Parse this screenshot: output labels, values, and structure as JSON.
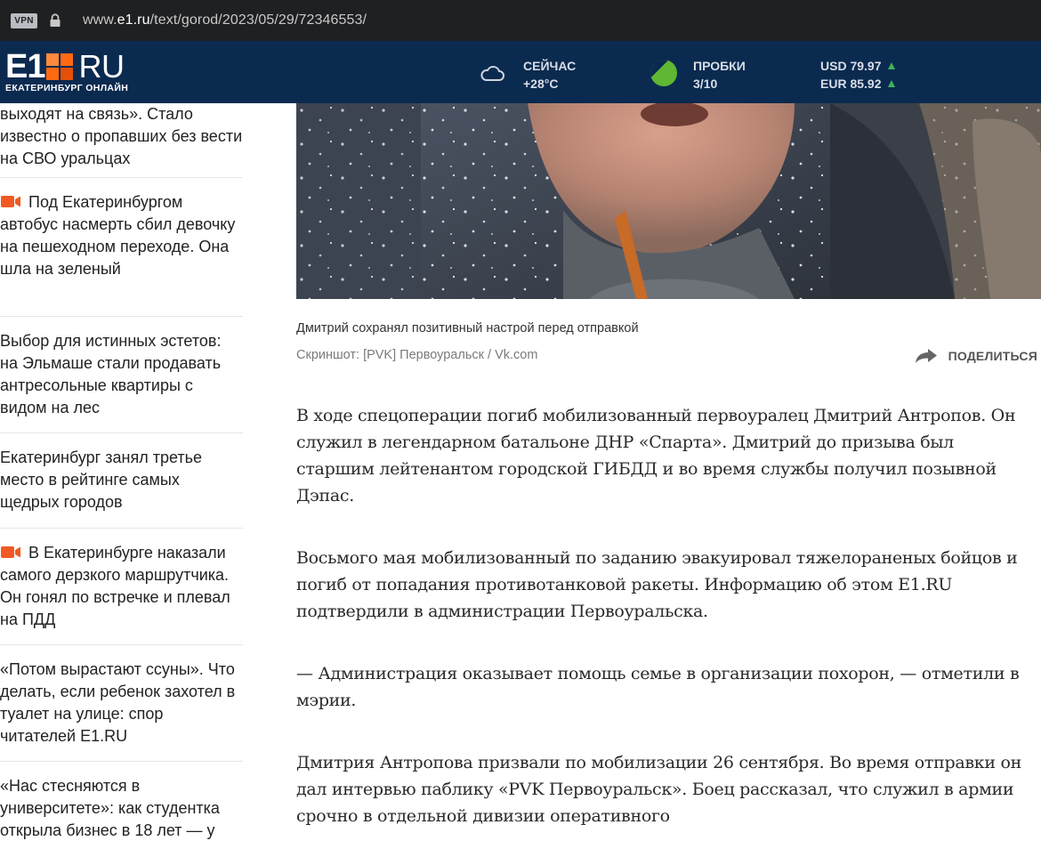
{
  "browser": {
    "vpn_badge": "VPN",
    "url_prefix": "www.",
    "url_domain": "e1.ru",
    "url_path": "/text/gorod/2023/05/29/72346553/"
  },
  "header": {
    "logo_e1": "E1",
    "logo_ru": "RU",
    "tagline": "ЕКАТЕРИНБУРГ ОНЛАЙН",
    "weather_label": "СЕЙЧАС",
    "weather_value": "+28°C",
    "traffic_label": "ПРОБКИ",
    "traffic_value": "3/10",
    "usd": "USD 79.97",
    "eur": "EUR 85.92",
    "colors": {
      "bg": "#0b2a4f",
      "traffic": "#5fb733",
      "rate_up": "#3fb35b",
      "logo_accent": "#ff6a13"
    }
  },
  "news": [
    {
      "text": "выходят на связь». Стало известно о пропавших без вести на СВО уральцах",
      "video": false
    },
    {
      "text": "Под Екатеринбургом автобус насмерть сбил девочку на пешеходном переходе. Она шла на зеленый",
      "video": true
    },
    {
      "text": "Выбор для истинных эстетов: на Эльмаше стали продавать антресольные квартиры с видом на лес",
      "video": false
    },
    {
      "text": "Екатеринбург занял третье место в рейтинге самых щедрых городов",
      "video": false
    },
    {
      "text": "В Екатеринбурге наказали самого дерзкого маршрутчика. Он гонял по встречке и плевал на ПДД",
      "video": true
    },
    {
      "text": "«Потом вырастают ссуны». Что делать, если ребенок захотел в туалет на улице: спор читателей E1.RU",
      "video": false
    },
    {
      "text": "«Нас стесняются в университете»: как студентка открыла бизнес в 18 лет — у",
      "video": false
    }
  ],
  "article": {
    "caption": "Дмитрий сохранял позитивный настрой перед отправкой",
    "credit": "Скриншот: [PVK] Первоуральск / Vk.com",
    "share_label": "ПОДЕЛИТЬСЯ",
    "paragraphs": [
      "В ходе спецоперации погиб мобилизованный первоуралец Дмитрий Антропов. Он служил в легендарном батальоне ДНР «Спарта». Дмитрий до призыва был старшим лейтенантом городской ГИБДД и во время службы получил позывной Дэпас.",
      "Восьмого мая мобилизованный по заданию эвакуировал тяжелораненых бойцов и погиб от попадания противотанковой ракеты. Информацию об этом E1.RU подтвердили в администрации Первоуральска.",
      "— Администрация оказывает помощь семье в организации похорон, — отметили в мэрии.",
      "Дмитрия Антропова призвали по мобилизации 26 сентября. Во время отправки он дал интервью паблику «PVK Первоуральск». Боец рассказал, что служил в армии срочно в отдельной дивизии оперативного"
    ]
  }
}
